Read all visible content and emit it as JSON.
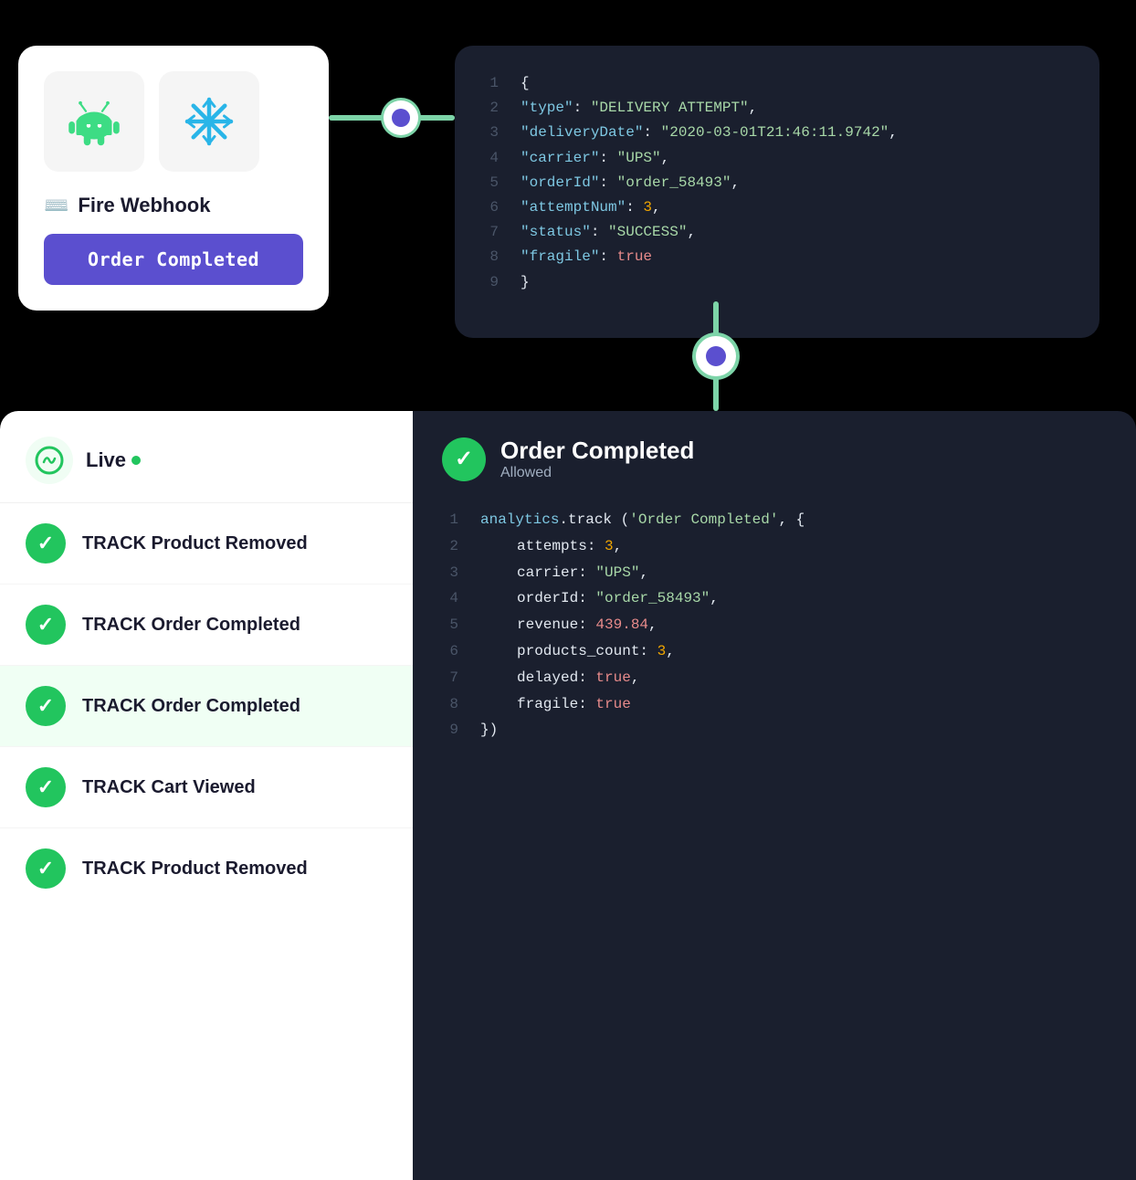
{
  "topCard": {
    "fireWebhookLabel": "Fire Webhook",
    "orderCompletedBtn": "Order Completed"
  },
  "jsonTop": {
    "lines": [
      {
        "num": "1",
        "content": "{"
      },
      {
        "num": "2",
        "content": "  \"type\": \"DELIVERY ATTEMPT\","
      },
      {
        "num": "3",
        "content": "  \"deliveryDate\": \"2020-03-01T21:46:11.9742\","
      },
      {
        "num": "4",
        "content": "  \"carrier\": \"UPS\","
      },
      {
        "num": "5",
        "content": "  \"orderId\": \"order_58493\","
      },
      {
        "num": "6",
        "content": "  \"attemptNum\": 3,"
      },
      {
        "num": "7",
        "content": "  \"status\": \"SUCCESS\","
      },
      {
        "num": "8",
        "content": "  \"fragile\": true"
      },
      {
        "num": "9",
        "content": "}"
      }
    ]
  },
  "header": {
    "liveLabel": "Live",
    "liveDot": true
  },
  "eventList": [
    {
      "id": "1",
      "label": "TRACK Product Removed",
      "active": false
    },
    {
      "id": "2",
      "label": "TRACK Order Completed",
      "active": false
    },
    {
      "id": "3",
      "label": "TRACK Order Completed",
      "active": true
    },
    {
      "id": "4",
      "label": "TRACK Cart Viewed",
      "active": false
    },
    {
      "id": "5",
      "label": "TRACK Product Removed",
      "active": false
    }
  ],
  "detail": {
    "title": "Order Completed",
    "subtitle": "Allowed",
    "codeLines": [
      {
        "num": "1",
        "text": "analytics.track ('Order Completed', {"
      },
      {
        "num": "2",
        "text": "    attempts: 3,"
      },
      {
        "num": "3",
        "text": "    carrier: \"UPS\","
      },
      {
        "num": "4",
        "text": "    orderId: \"order_58493\","
      },
      {
        "num": "5",
        "text": "    revenue: 439.84,"
      },
      {
        "num": "6",
        "text": "    products_count: 3,"
      },
      {
        "num": "7",
        "text": "    delayed: true,"
      },
      {
        "num": "8",
        "text": "    fragile: true"
      },
      {
        "num": "9",
        "text": "})"
      }
    ]
  }
}
